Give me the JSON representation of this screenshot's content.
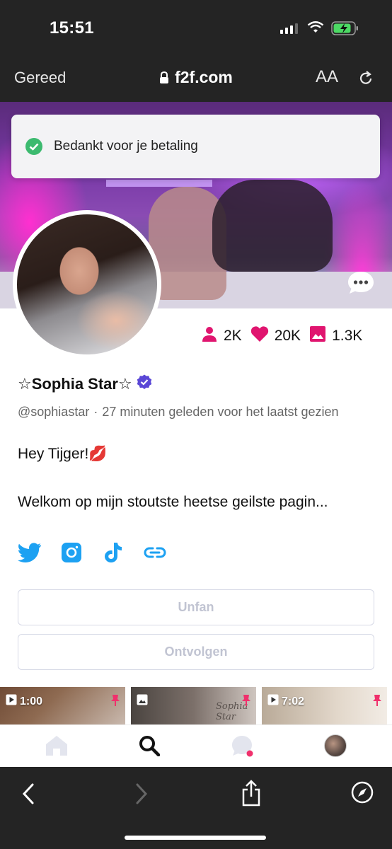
{
  "status_bar": {
    "time": "15:51",
    "battery_icon": "battery-charging-icon"
  },
  "browser": {
    "done_label": "Gereed",
    "url": "f2f.com",
    "text_size_label": "AA"
  },
  "toast": {
    "message": "Bedankt voor je betaling",
    "icon": "check-circle-icon",
    "color": "#3cba6f"
  },
  "profile": {
    "name": "☆Sophia Star☆",
    "verified": true,
    "handle": "@sophiastar",
    "separator": "·",
    "last_seen": "27 minuten geleden voor het laatst gezien",
    "bio_line1": "Hey Tijger!💋",
    "bio_line2": "Welkom op mijn stoutste heetse geilste pagin...",
    "stats": [
      {
        "icon": "fans-icon",
        "value": "2K"
      },
      {
        "icon": "heart-icon",
        "value": "20K"
      },
      {
        "icon": "image-icon",
        "value": "1.3K"
      }
    ],
    "accent_color": "#e0156f",
    "socials": [
      "twitter-icon",
      "instagram-icon",
      "tiktok-icon",
      "link-icon"
    ],
    "social_color": "#1da1f2"
  },
  "actions": {
    "unfan_label": "Unfan",
    "unfollow_label": "Ontvolgen"
  },
  "media": [
    {
      "type": "video",
      "duration": "1:00",
      "pinned": true
    },
    {
      "type": "image",
      "watermark": "Sophia Star",
      "pinned": true
    },
    {
      "type": "video",
      "duration": "7:02",
      "pinned": true
    }
  ],
  "app_nav": [
    "home-icon",
    "search-icon",
    "messages-icon",
    "profile-avatar"
  ],
  "safari_toolbar": [
    "back-icon",
    "forward-icon",
    "share-icon",
    "compass-icon"
  ]
}
